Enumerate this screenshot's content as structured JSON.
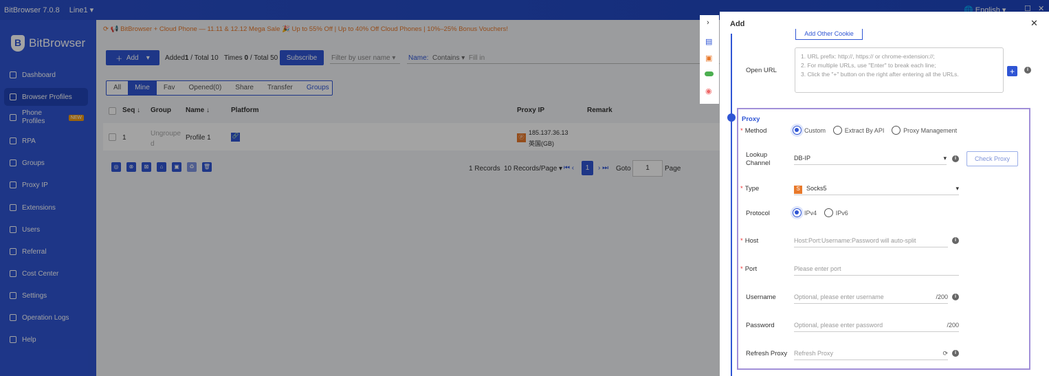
{
  "app": {
    "title": "BitBrowser 7.0.8",
    "line": "Line1",
    "language": "English"
  },
  "sidebar": {
    "brand": "BitBrowser",
    "items": [
      {
        "label": "Dashboard"
      },
      {
        "label": "Browser Profiles",
        "active": true
      },
      {
        "label": "Phone Profiles",
        "badge": "NEW"
      },
      {
        "label": "RPA"
      },
      {
        "label": "Groups"
      },
      {
        "label": "Proxy IP"
      },
      {
        "label": "Extensions"
      },
      {
        "label": "Users"
      },
      {
        "label": "Referral"
      },
      {
        "label": "Cost Center"
      },
      {
        "label": "Settings"
      },
      {
        "label": "Operation Logs"
      },
      {
        "label": "Help"
      }
    ]
  },
  "main": {
    "banner": "BitBrowser + Cloud Phone — 11.11 & 12.12 Mega Sale 🎉 Up to 55% Off | Up to 40% Off Cloud Phones | 10%–25% Bonus Vouchers!",
    "toolbar": {
      "add": "Add",
      "added_label": "Added",
      "added": "1",
      "total_label": "/ Total 10",
      "times_label": "Times",
      "times": "0",
      "times_total": "/ Total 50",
      "subscribe": "Subscribe",
      "filter_placeholder": "Filter by user name",
      "name_label": "Name:",
      "contains": "Contains",
      "fill_placeholder": "Fill in"
    },
    "tabs": [
      "All",
      "Mine",
      "Fav",
      "Opened(0)",
      "Share",
      "Transfer",
      "Groups"
    ],
    "columns": [
      "Seq",
      "Group",
      "Name",
      "Platform",
      "Proxy IP",
      "Remark"
    ],
    "rows": [
      {
        "seq": "1",
        "group": "Ungrouped",
        "name": "Profile 1",
        "ip": "185.137.36.13",
        "country": "英国(GB)"
      }
    ],
    "pagination": {
      "records": "1 Records",
      "per_page": "10 Records/Page",
      "page": "1",
      "goto": "Goto",
      "goto_value": "1",
      "page_label": "Page"
    }
  },
  "drawer": {
    "title": "Add",
    "add_cookie": "Add Other Cookie",
    "open_url_label": "Open URL",
    "open_url_placeholder": "1. URL prefix: http://, https:// or chrome-extension://;\n2. For multiple URLs, use \"Enter\" to break each line;\n3. Click the \"+\" button on the right after entering all the URLs.",
    "proxy": {
      "section": "Proxy",
      "method_label": "Method",
      "methods": [
        "Custom",
        "Extract By API",
        "Proxy Management"
      ],
      "method_selected": "Custom",
      "lookup_label": "Lookup Channel",
      "lookup_value": "DB-IP",
      "check_proxy": "Check Proxy",
      "type_label": "Type",
      "type_value": "Socks5",
      "protocol_label": "Protocol",
      "protocols": [
        "IPv4",
        "IPv6"
      ],
      "protocol_selected": "IPv4",
      "host_label": "Host",
      "host_placeholder": "Host:Port:Username:Password will auto-split",
      "port_label": "Port",
      "port_placeholder": "Please enter port",
      "username_label": "Username",
      "username_placeholder": "Optional, please enter username",
      "username_counter": "/200",
      "password_label": "Password",
      "password_placeholder": "Optional, please enter password",
      "password_counter": "/200",
      "refresh_label": "Refresh Proxy",
      "refresh_placeholder": "Refresh Proxy"
    }
  },
  "colors": {
    "primary": "#2f55d4",
    "accent": "#e8792b",
    "section_border": "#a18fd8"
  }
}
